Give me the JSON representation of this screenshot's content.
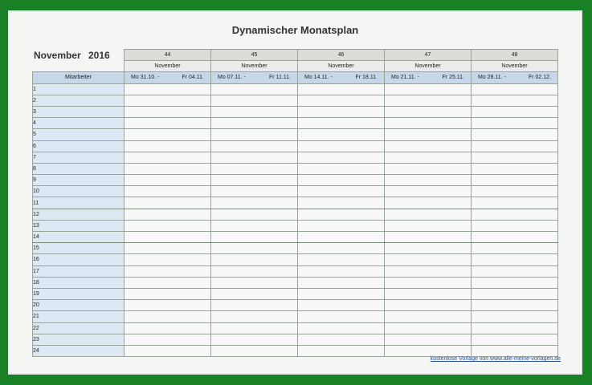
{
  "title": "Dynamischer Monatsplan",
  "month": "November",
  "year": "2016",
  "employee_header": "Mitarbeiter",
  "weeks": [
    {
      "number": "44",
      "month": "November",
      "start": "Mo 31.10. -",
      "end": "Fr 04.11."
    },
    {
      "number": "45",
      "month": "November",
      "start": "Mo 07.11. -",
      "end": "Fr 11.11."
    },
    {
      "number": "46",
      "month": "November",
      "start": "Mo 14.11. -",
      "end": "Fr 18.11."
    },
    {
      "number": "47",
      "month": "November",
      "start": "Mo 21.11. -",
      "end": "Fr 25.11."
    },
    {
      "number": "48",
      "month": "November",
      "start": "Mo 28.11. -",
      "end": "Fr 02.12."
    }
  ],
  "rows": [
    "1",
    "2",
    "3",
    "4",
    "5",
    "6",
    "7",
    "8",
    "9",
    "10",
    "11",
    "12",
    "13",
    "14",
    "15",
    "16",
    "17",
    "18",
    "19",
    "20",
    "21",
    "22",
    "23",
    "24"
  ],
  "footer_text": "kostenlose Vorlage von www.alle-meine-vorlagen.de",
  "colors": {
    "background": "#1a8026",
    "header_blue": "#c6d7ea",
    "header_gray": "#dcdcd8"
  }
}
